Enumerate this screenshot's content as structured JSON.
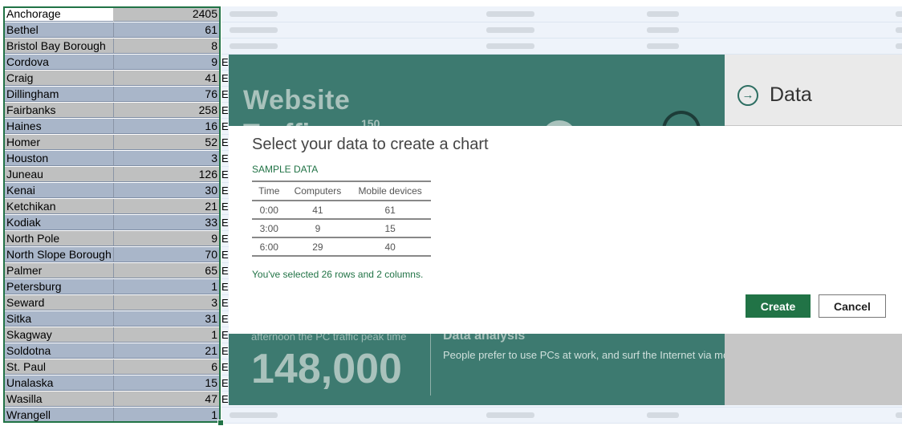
{
  "sheet": {
    "rows": [
      {
        "name": "Anchorage",
        "value": "2405",
        "col_c": ""
      },
      {
        "name": "Bethel",
        "value": "61",
        "col_c": ""
      },
      {
        "name": "Bristol Bay Borough",
        "value": "8",
        "col_c": ""
      },
      {
        "name": "Cordova",
        "value": "9",
        "col_c": "E"
      },
      {
        "name": "Craig",
        "value": "41",
        "col_c": "E"
      },
      {
        "name": "Dillingham",
        "value": "76",
        "col_c": "E"
      },
      {
        "name": "Fairbanks",
        "value": "258",
        "col_c": "E"
      },
      {
        "name": "Haines",
        "value": "16",
        "col_c": "E"
      },
      {
        "name": "Homer",
        "value": "52",
        "col_c": "E"
      },
      {
        "name": "Houston",
        "value": "3",
        "col_c": "E"
      },
      {
        "name": "Juneau",
        "value": "126",
        "col_c": "E"
      },
      {
        "name": "Kenai",
        "value": "30",
        "col_c": "E"
      },
      {
        "name": "Ketchikan",
        "value": "21",
        "col_c": "E"
      },
      {
        "name": "Kodiak",
        "value": "33",
        "col_c": "E"
      },
      {
        "name": "North Pole",
        "value": "9",
        "col_c": "E"
      },
      {
        "name": "North Slope Borough",
        "value": "70",
        "col_c": "E"
      },
      {
        "name": "Palmer",
        "value": "65",
        "col_c": "E"
      },
      {
        "name": "Petersburg",
        "value": "1",
        "col_c": "E"
      },
      {
        "name": "Seward",
        "value": "3",
        "col_c": "E"
      },
      {
        "name": "Sitka",
        "value": "31",
        "col_c": "E"
      },
      {
        "name": "Skagway",
        "value": "1",
        "col_c": "E"
      },
      {
        "name": "Soldotna",
        "value": "21",
        "col_c": "E"
      },
      {
        "name": "St. Paul",
        "value": "6",
        "col_c": "E"
      },
      {
        "name": "Unalaska",
        "value": "15",
        "col_c": "E"
      },
      {
        "name": "Wasilla",
        "value": "47",
        "col_c": "E"
      },
      {
        "name": "Wrangell",
        "value": "1",
        "col_c": ""
      }
    ]
  },
  "background": {
    "headline": "Website",
    "headline_2": "Traffic",
    "badge": "150",
    "peak_text": "afternoon the PC traffic peak time",
    "big_number": "148,000",
    "section_title": "Data analysis",
    "section_text": "People prefer to use PCs  at work, and surf the Internet via mo"
  },
  "side_panel": {
    "label": "Data",
    "icon": "arrow-right-circle-icon"
  },
  "dialog": {
    "title": "Select your data to create a chart",
    "section_label": "SAMPLE DATA",
    "table": {
      "headers": [
        "Time",
        "Computers",
        "Mobile devices"
      ],
      "rows": [
        [
          "0:00",
          "41",
          "61"
        ],
        [
          "3:00",
          "9",
          "15"
        ],
        [
          "6:00",
          "29",
          "40"
        ]
      ]
    },
    "selected_message": "You've selected 26 rows and 2 columns.",
    "create_label": "Create",
    "cancel_label": "Cancel"
  },
  "colors": {
    "accent": "#217346",
    "teal_panel": "#3d7a70"
  }
}
